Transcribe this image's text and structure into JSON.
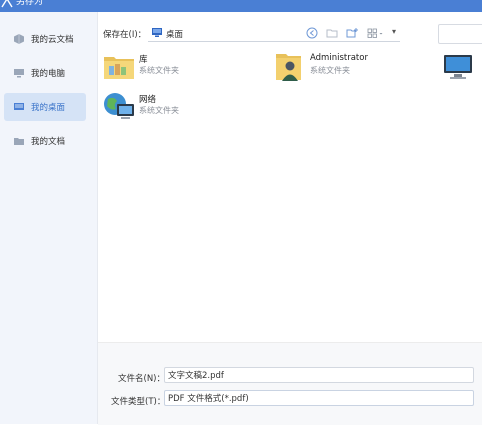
{
  "window": {
    "title": "另存为",
    "accent": "#4a7fd4"
  },
  "sidebar": {
    "items": [
      {
        "label": "我的云文档",
        "icon": "cloud-doc-icon",
        "active": false
      },
      {
        "label": "我的电脑",
        "icon": "computer-icon",
        "active": false
      },
      {
        "label": "我的桌面",
        "icon": "desktop-icon",
        "active": true
      },
      {
        "label": "我的文档",
        "icon": "folder-icon",
        "active": false
      }
    ]
  },
  "toolbar": {
    "location_label": "保存在(I)：",
    "location_value": "桌面",
    "buttons": [
      "back-icon",
      "up-folder-icon",
      "new-folder-icon",
      "view-menu-icon"
    ]
  },
  "files": [
    {
      "name": "库",
      "type": "系统文件夹",
      "icon": "library-folder-icon"
    },
    {
      "name": "Administrator",
      "type": "系统文件夹",
      "icon": "user-folder-icon"
    },
    {
      "name": "",
      "type": "",
      "icon": "computer-icon"
    },
    {
      "name": "网络",
      "type": "系统文件夹",
      "icon": "network-icon"
    }
  ],
  "footer": {
    "filename_label": "文件名(N)：",
    "filename_value": "文字文稿2.pdf",
    "filetype_label": "文件类型(T)：",
    "filetype_value": "PDF 文件格式(*.pdf)"
  }
}
